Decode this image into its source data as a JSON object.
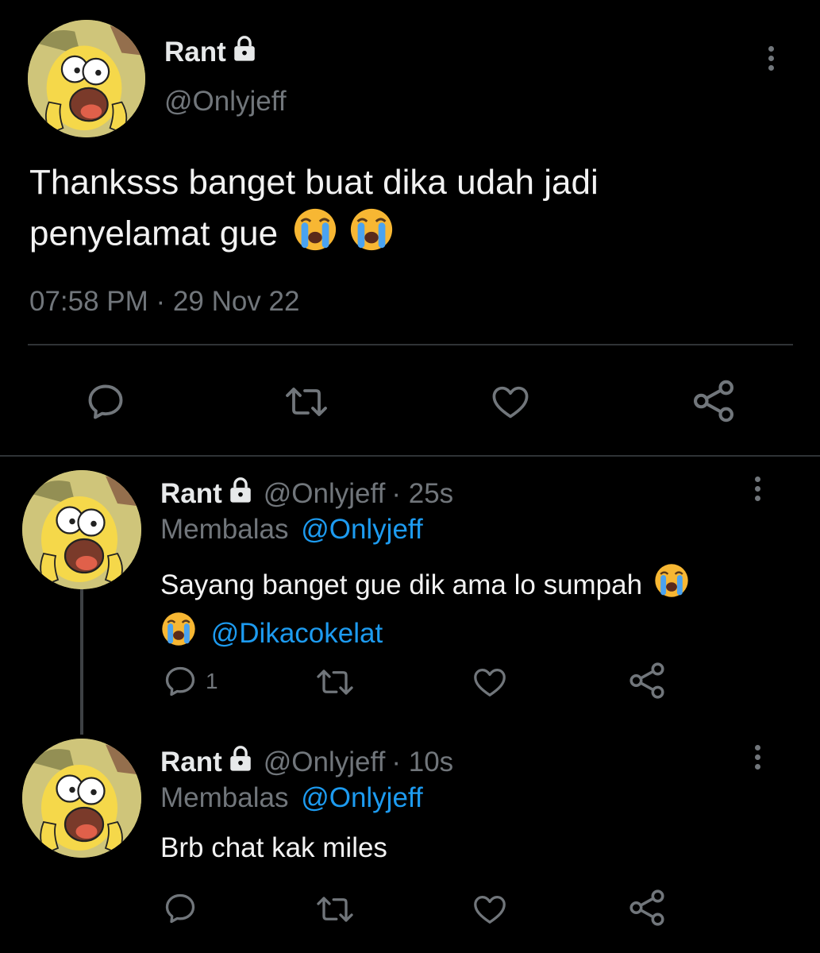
{
  "main_tweet": {
    "display_name": "Rant",
    "handle": "@Onlyjeff",
    "text_line1": "Thanksss banget buat dika udah jadi",
    "text_line2": "penyelamat gue",
    "timestamp": "07:58 PM · 29 Nov 22",
    "emoji": [
      "loudly-crying-face",
      "loudly-crying-face"
    ]
  },
  "replies": [
    {
      "display_name": "Rant",
      "handle": "@Onlyjeff",
      "time": "· 25s",
      "replying_label": "Membalas",
      "replying_to": "@Onlyjeff",
      "text_line1": "Sayang banget gue dik ama lo sumpah",
      "mention": "@Dikacokelat",
      "reply_count": "1"
    },
    {
      "display_name": "Rant",
      "handle": "@Onlyjeff",
      "time": "· 10s",
      "replying_label": "Membalas",
      "replying_to": "@Onlyjeff",
      "text_line1": "Brb chat kak miles",
      "reply_count": ""
    }
  ],
  "colors": {
    "background": "#000000",
    "text": "#e7e9ea",
    "secondary": "#71767b",
    "link": "#1d9bf0",
    "divider": "#2f3336"
  },
  "icons": [
    "lock-icon",
    "more-options-icon",
    "reply-icon",
    "retweet-icon",
    "like-icon",
    "share-icon",
    "avatar"
  ]
}
